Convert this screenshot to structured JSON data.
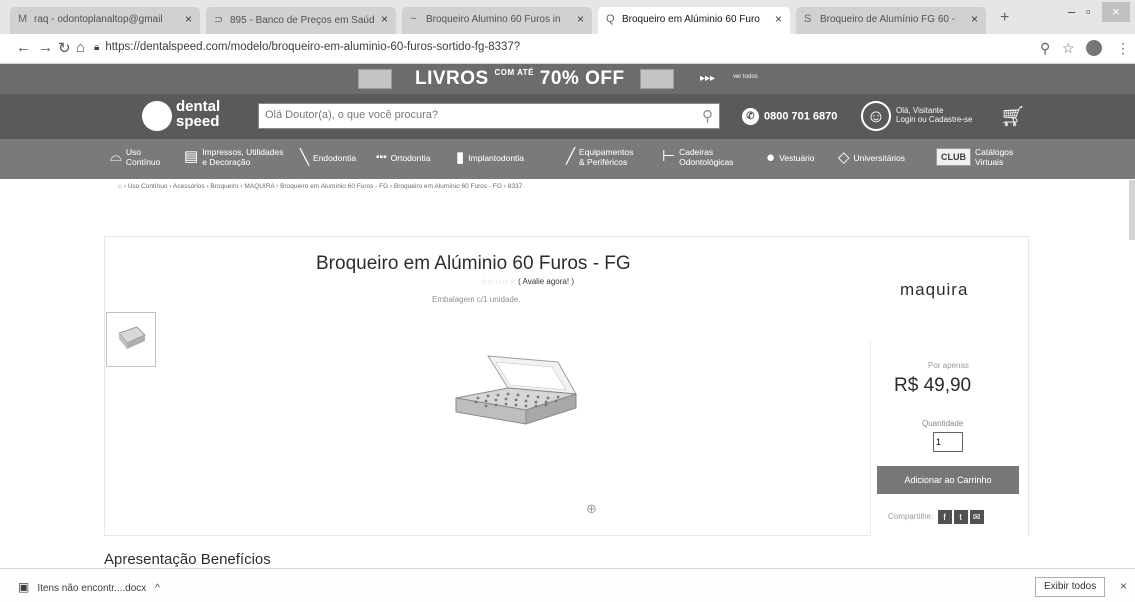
{
  "browser": {
    "tabs": [
      {
        "icon": "M",
        "label": "raq - odontoplanaltop@gmail"
      },
      {
        "icon": "⊃",
        "label": "895 - Banco de Preços em Saúd"
      },
      {
        "icon": "~",
        "label": "Broqueiro Alumino 60 Furos in"
      },
      {
        "icon": "Q",
        "label": "Broqueiro em Alúminio 60 Furo"
      },
      {
        "icon": "S",
        "label": "Broqueiro de Alumínio FG 60 -"
      }
    ],
    "url": "https://dentalspeed.com/modelo/broqueiro-em-aluminio-60-furos-sortido-fg-8337?"
  },
  "promo": {
    "livros": "LIVROS",
    "com_ate": "COM ATÉ",
    "off": "70% OFF",
    "more": "▸▸▸",
    "sub": "ver todos"
  },
  "header": {
    "logo_line1": "dental",
    "logo_line2": "speed",
    "search_placeholder": "Olá Doutor(a), o que você procura?",
    "phone": "0800 701 6870",
    "user_line1": "Olá, Visitante",
    "user_line2": "Login ou Cadastre-se"
  },
  "categories": [
    {
      "line1": "Uso",
      "line2": "Contínuo"
    },
    {
      "line1": "Impressos, Utilidades",
      "line2": "e Decoração"
    },
    {
      "line1": "Endodontia",
      "line2": ""
    },
    {
      "line1": "Ortodontia",
      "line2": ""
    },
    {
      "line1": "Implantodontia",
      "line2": ""
    },
    {
      "line1": "Equipamentos",
      "line2": "& Periféricos"
    },
    {
      "line1": "Cadeiras",
      "line2": "Odontológicas"
    },
    {
      "line1": "Vestuário",
      "line2": ""
    },
    {
      "line1": "Universitários",
      "line2": ""
    },
    {
      "line1": "Catálogos",
      "line2": "Virtuais"
    }
  ],
  "club_label": "CLUB",
  "breadcrumb": "⌂ › Uso Contínuo › Acessórios › Broqueiro › MAQUIRA › Broqueiro em Alumínio 60 Furos - FG › Broqueiro em Alumínio 60 Furos - FG › 8337",
  "product": {
    "title": "Broqueiro em Alúminio 60 Furos - FG",
    "stars": "☆☆☆☆☆",
    "rate_link": "( Avalie agora! )",
    "packaging": "Embalagem c/1 unidade.",
    "brand": "maquira",
    "price_prefix": "Por apenas",
    "price": "R$ 49,90",
    "quantity_label": "Quantidade",
    "quantity_value": "1",
    "add_to_cart": "Adicionar ao Carrinho",
    "share_label": "Compartilhe:"
  },
  "section_title": "Apresentação Benefícios",
  "downloads": {
    "file": "Itens não encontr....docx",
    "show_all": "Exibir todos"
  }
}
